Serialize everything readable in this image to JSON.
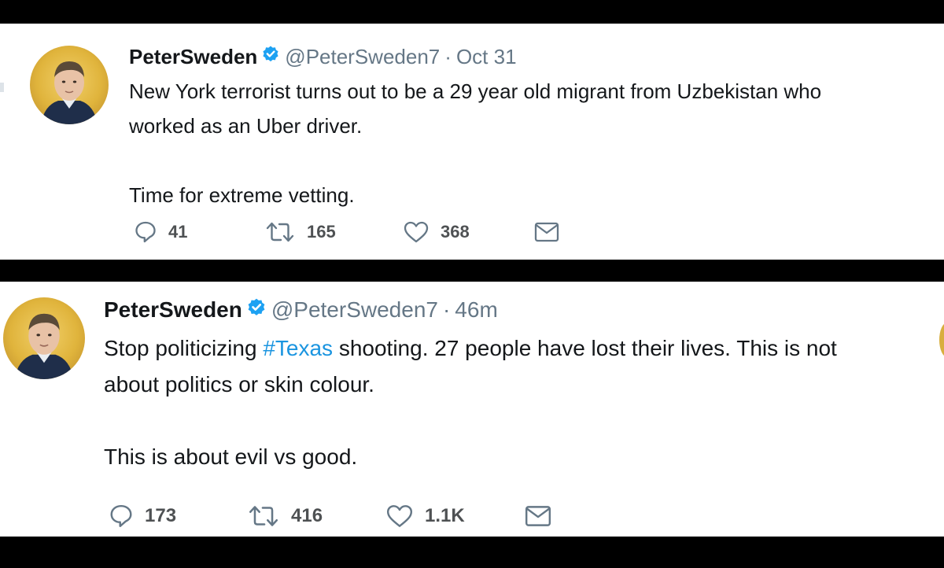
{
  "tweets": [
    {
      "name": "PeterSweden",
      "handle": "@PeterSweden7",
      "separator": "·",
      "time": "Oct 31",
      "text_lines": [
        "New York terrorist turns out to be a 29 year old migrant from Uzbekistan who",
        "worked as an Uber driver.",
        "",
        "Time for extreme vetting."
      ],
      "replies": "41",
      "retweets": "165",
      "likes": "368"
    },
    {
      "name": "PeterSweden",
      "handle": "@PeterSweden7",
      "separator": "·",
      "time": "46m",
      "text_part1": "Stop politicizing ",
      "hashtag": "#Texas",
      "text_part2": " shooting. 27 people have lost their lives. This is not\nabout politics or skin colour.\n\nThis is about evil vs good.",
      "replies": "173",
      "retweets": "416",
      "likes": "1.1K"
    }
  ],
  "icons": {
    "verified": "verified-badge-icon",
    "reply": "reply-icon",
    "retweet": "retweet-icon",
    "like": "heart-icon",
    "message": "direct-message-icon"
  },
  "colors": {
    "verified_blue": "#1da1f2",
    "hashtag_blue": "#1b95e0",
    "muted_gray": "#657786",
    "avatar_gold": "#e0b43c"
  }
}
